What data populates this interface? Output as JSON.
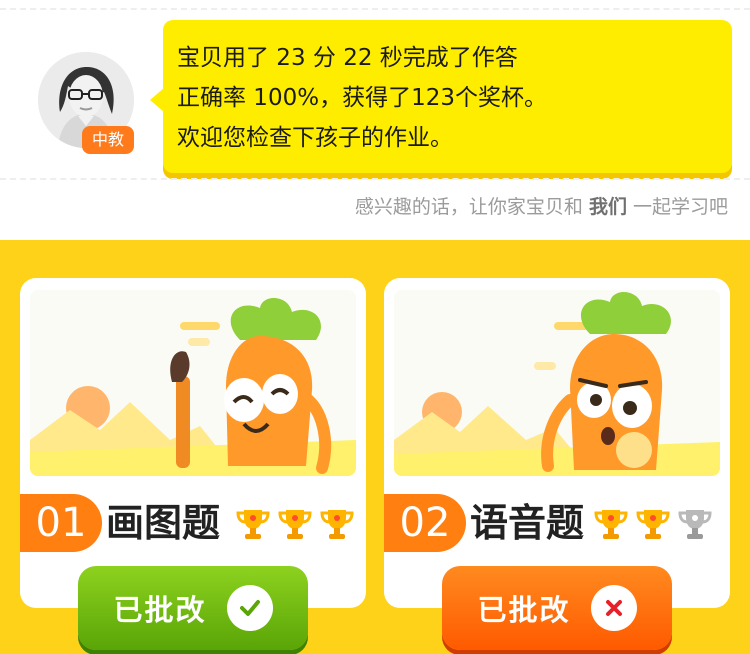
{
  "teacher": {
    "role_badge": "中教",
    "message_lines": [
      "宝贝用了 23 分 22 秒完成了作答",
      "正确率 100%，获得了123个奖杯。",
      "欢迎您检查下孩子的作业。"
    ]
  },
  "invite": {
    "prefix": "感兴趣的话，让你家宝贝和 ",
    "emphasis": "我们",
    "suffix": " 一起学习吧"
  },
  "tasks": [
    {
      "number": "01",
      "title": "画图题",
      "trophies": [
        "gold",
        "gold",
        "gold"
      ],
      "status_label": "已批改",
      "result_icon": "check-icon",
      "button_color": "#6cbc10"
    },
    {
      "number": "02",
      "title": "语音题",
      "trophies": [
        "gold",
        "gold",
        "silver"
      ],
      "status_label": "已批改",
      "result_icon": "cross-icon",
      "button_color": "#ff6a0a"
    }
  ],
  "colors": {
    "panel_bg": "#ffd21a",
    "bubble_bg": "#ffed00",
    "accent_orange": "#ff7f11"
  }
}
